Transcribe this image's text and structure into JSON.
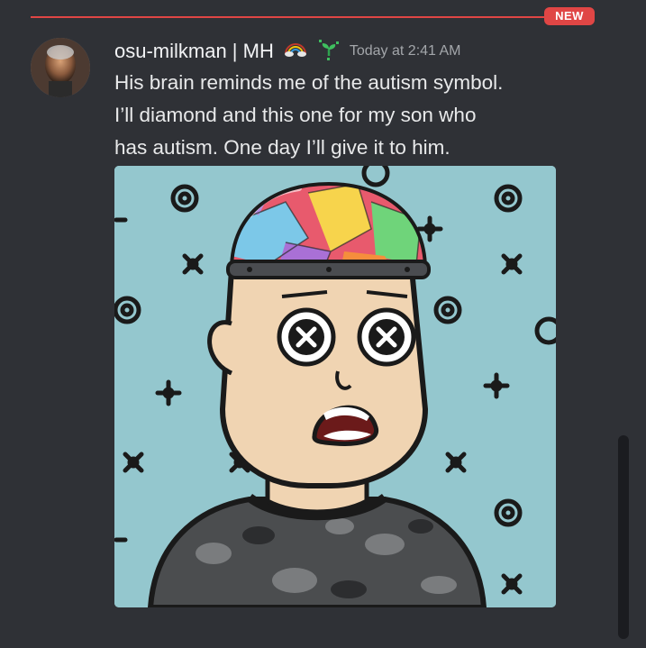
{
  "divider": {
    "badge": "NEW"
  },
  "message": {
    "author": "osu-milkman | MH",
    "timestamp": "Today at 2:41 AM",
    "lines": [
      "His brain reminds me of the autism symbol.",
      "I’ll diamond and this one for my son who",
      "has autism. One day I’ll give it to him."
    ]
  },
  "icons": {
    "role_badge_1": "rainbow-cloud-icon",
    "role_badge_2": "sprout-icon"
  },
  "colors": {
    "background": "#2f3136",
    "new_divider": "#e04645",
    "username": "#f2f3f5",
    "message_text": "#e8e9ea",
    "timestamp": "#a3a6aa",
    "image_background": "#94c7ce"
  }
}
